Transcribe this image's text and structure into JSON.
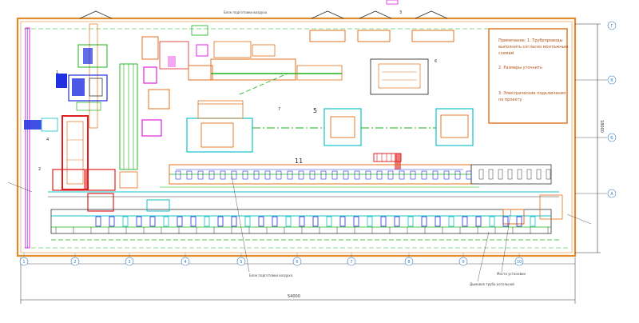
{
  "labels": {
    "top_note": "Блок подготовки воздуха",
    "legend_line1": "Примечание: 1. Трубопроводы",
    "legend_line2": "выполнить согласно монтажным",
    "legend_line3": "схемам",
    "legend_line4": "2. Размеры уточнить",
    "legend_line5": "3. Электрические подключения",
    "legend_line6": "по проекту",
    "bottom_note1": "Блок подготовки воздуха",
    "bottom_note2": "Место установки",
    "bottom_note3": "Дымовая труба котельной",
    "bottom_dim": "54000",
    "right_dim": "18000",
    "marker_5": "5",
    "marker_3": "3",
    "marker_11": "11",
    "marker_1": "1",
    "marker_2": "2",
    "marker_4": "4",
    "marker_6": "6",
    "marker_7": "7"
  },
  "axes_bottom": [
    "1",
    "2",
    "3",
    "4",
    "5",
    "6",
    "7",
    "8",
    "9",
    "10"
  ],
  "axes_right": [
    "Г",
    "В",
    "Б",
    "А"
  ],
  "colors": {
    "wall": "#e58a2b",
    "orange": "#e0701a",
    "red": "#e02020",
    "green": "#18b018",
    "cyan": "#10c0c8",
    "blue": "#2030e0",
    "magenta": "#e020e0",
    "dim": "#333333",
    "axis": "#3a7fbf"
  }
}
